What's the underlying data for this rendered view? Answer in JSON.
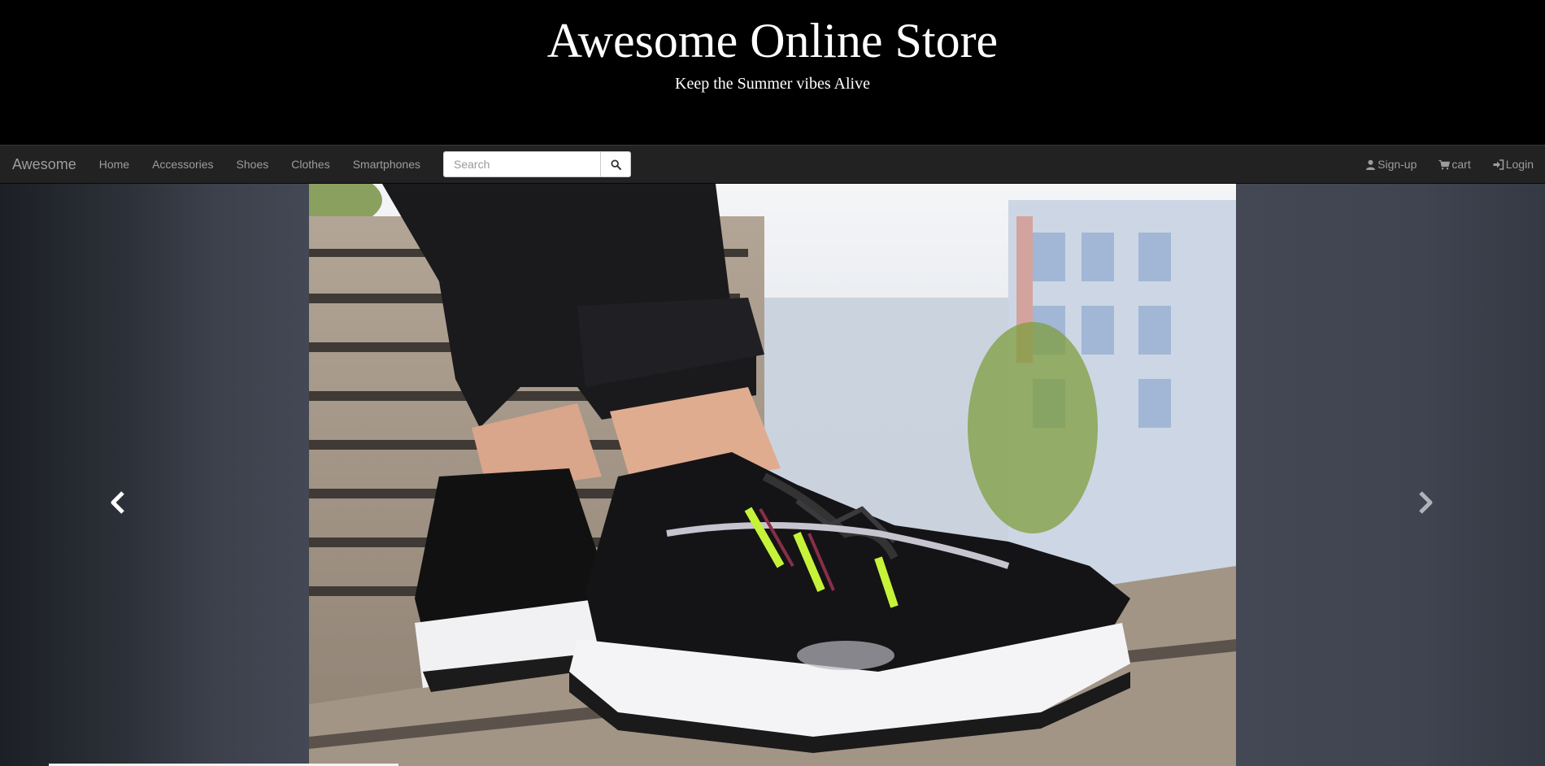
{
  "header": {
    "title": "Awesome Online Store",
    "tagline": "Keep the Summer vibes Alive"
  },
  "navbar": {
    "brand": "Awesome",
    "links": [
      "Home",
      "Accessories",
      "Shoes",
      "Clothes",
      "Smartphones"
    ],
    "search": {
      "placeholder": "Search",
      "value": ""
    },
    "right_links": [
      {
        "label": "Sign-up",
        "icon": "user-icon"
      },
      {
        "label": "cart",
        "icon": "cart-icon"
      },
      {
        "label": "Login",
        "icon": "login-icon"
      }
    ]
  },
  "carousel": {
    "slide_subject": "sneaker-on-bench",
    "prev_icon": "chevron-left-icon",
    "next_icon": "chevron-right-icon"
  },
  "colors": {
    "header_bg": "#000000",
    "navbar_bg": "#222222",
    "nav_text": "#9d9d9d",
    "carousel_bg": "#434854"
  }
}
